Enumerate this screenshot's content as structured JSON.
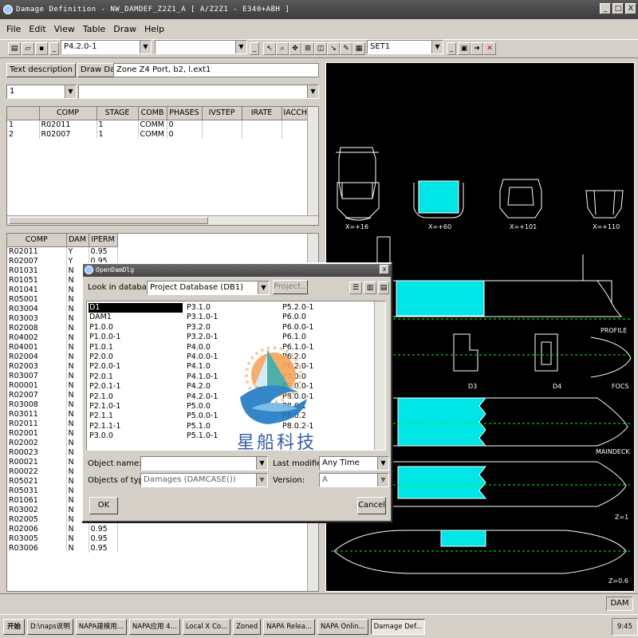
{
  "window": {
    "title": "Damage Definition - NW_DAMDEF_Z2Z1_A [ A/Z2Z1 - E340+ABH ]",
    "controls": [
      "_",
      "□",
      "X"
    ]
  },
  "menu": [
    "File",
    "Edit",
    "View",
    "Table",
    "Draw",
    "Help"
  ],
  "toolbar": {
    "version_value": "P4.2.0-1",
    "set_value": "SET1"
  },
  "left_panel": {
    "text_desc_button": "Text description",
    "draw_damage_button": "Draw Damage",
    "zone_text": "Zone Z4 Port, b2, l.ext1",
    "selector_value": "1",
    "grid1": {
      "headers": [
        "",
        "COMP",
        "STAGE",
        "COMB",
        "PHASES",
        "IVSTEP",
        "IRATE",
        "IACCH"
      ],
      "rows": [
        [
          "1",
          "R02011",
          "1",
          "COMM",
          "0",
          "",
          "",
          ""
        ],
        [
          "2",
          "R02007",
          "1",
          "COMM",
          "0",
          "",
          "",
          ""
        ]
      ]
    },
    "grid2": {
      "headers": [
        "COMP",
        "DAM",
        "IPERM"
      ],
      "rows": [
        [
          "R02011",
          "Y",
          "0.95"
        ],
        [
          "R02007",
          "Y",
          "0.95"
        ],
        [
          "R01031",
          "N",
          ""
        ],
        [
          "R01051",
          "N",
          ""
        ],
        [
          "R01041",
          "N",
          ""
        ],
        [
          "R05001",
          "N",
          ""
        ],
        [
          "R03004",
          "N",
          ""
        ],
        [
          "R03003",
          "N",
          ""
        ],
        [
          "R02008",
          "N",
          ""
        ],
        [
          "R04002",
          "N",
          ""
        ],
        [
          "R04001",
          "N",
          ""
        ],
        [
          "R02004",
          "N",
          ""
        ],
        [
          "R02003",
          "N",
          ""
        ],
        [
          "R03007",
          "N",
          ""
        ],
        [
          "R00001",
          "N",
          ""
        ],
        [
          "R02007",
          "N",
          ""
        ],
        [
          "R03008",
          "N",
          ""
        ],
        [
          "R03011",
          "N",
          ""
        ],
        [
          "R02011",
          "N",
          ""
        ],
        [
          "R02001",
          "N",
          ""
        ],
        [
          "R02002",
          "N",
          ""
        ],
        [
          "R00023",
          "N",
          ""
        ],
        [
          "R00021",
          "N",
          ""
        ],
        [
          "R00022",
          "N",
          ""
        ],
        [
          "R05021",
          "N",
          ""
        ],
        [
          "R05031",
          "N",
          ""
        ],
        [
          "R01061",
          "N",
          "0.95"
        ],
        [
          "R03002",
          "N",
          "0.95"
        ],
        [
          "R02005",
          "N",
          "0.95"
        ],
        [
          "R02006",
          "N",
          "0.95"
        ],
        [
          "R03005",
          "N",
          "0.95"
        ],
        [
          "R03006",
          "N",
          "0.95"
        ]
      ]
    }
  },
  "drawing": {
    "labels": [
      "X=+16",
      "X=+60",
      "X=+101",
      "X=+110",
      "PROFILE",
      "D3",
      "D4",
      "FOCS",
      "MAINDECK",
      "Z=1",
      "Z=0.6"
    ],
    "fill_color": "#00e5e5"
  },
  "dialog": {
    "title": "OpenDamDlg",
    "close_label": "x",
    "look_in_label": "Look in database:",
    "look_in_value": "Project Database (DB1)",
    "project_button": "Project...",
    "list_col1": [
      "D1",
      "DAM1",
      "P1.0.0",
      "P1.0.0-1",
      "P1.0.1",
      "P2.0.0",
      "P2.0.0-1",
      "P2.0.1",
      "P2.0.1-1",
      "P2.1.0",
      "P2.1.0-1",
      "P2.1.1",
      "P2.1.1-1",
      "P3.0.0"
    ],
    "list_col2": [
      "P3.1.0",
      "P3.1.0-1",
      "P3.2.0",
      "P3.2.0-1",
      "P4.0.0",
      "P4.0.0-1",
      "P4.1.0",
      "P4.1.0-1",
      "P4.2.0",
      "P4.2.0-1",
      "P5.0.0",
      "P5.0.0-1",
      "P5.1.0",
      "P5.1.0-1"
    ],
    "list_col3": [
      "P5.2.0-1",
      "P6.0.0",
      "P6.0.0-1",
      "P6.1.0",
      "P6.1.0-1",
      "P6.2.0",
      "P6.2.0-1",
      "P7.0.0",
      "P7.0.0-1",
      "P8.0.0-1",
      "P8.0.1",
      "P8.0.2",
      "P8.0.2-1",
      ""
    ],
    "object_name_label": "Object name:",
    "object_name_value": "",
    "last_modified_label": "Last modified:",
    "last_modified_value": "Any Time",
    "objects_type_label": "Objects of type:",
    "objects_type_value": "Damages (DAMCASE())",
    "version_label": "Version:",
    "version_value": "A",
    "ok_button": "OK",
    "cancel_button": "Cancel",
    "watermark_text": "星船科技"
  },
  "statusbar": {
    "mode": "DAM"
  },
  "taskbar": {
    "start": "开始",
    "items": [
      "D:\\naps说明",
      "NAPA建模用...",
      "NAPA应用 4...",
      "Local X Co...",
      "Zoned",
      "NAPA Relea...",
      "NAPA Onlin...",
      "Damage Def..."
    ],
    "active_index": 7,
    "clock": "9:45"
  }
}
